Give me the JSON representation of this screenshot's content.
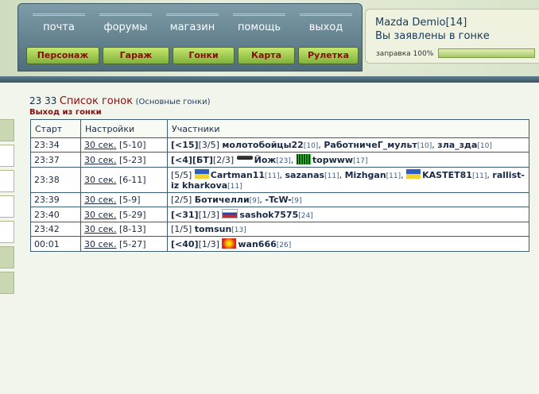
{
  "nav": {
    "links": [
      "почта",
      "форумы",
      "магазин",
      "помощь",
      "выход"
    ],
    "buttons": [
      "Персонаж",
      "Гараж",
      "Гонки",
      "Карта",
      "Рулетка"
    ]
  },
  "info": {
    "car": "Mazda Demio[14]",
    "status": "Вы заявлены в гонке",
    "fuel_label": "заправка 100%",
    "fuel_percent": 100
  },
  "page": {
    "time": "23 33",
    "title": "Список гонок",
    "subtitle": "(Основные гонки)",
    "exit_link": "Выход из гонки"
  },
  "table": {
    "headers": [
      "Старт",
      "Настройки",
      "Участники"
    ],
    "rows": [
      {
        "start": "23:34",
        "setting_link": "30 сек.",
        "setting_range": "[5-10]",
        "prefix": "[<15]",
        "count": "[3/5]",
        "participants": [
          {
            "name": "молотобойцы22",
            "level": "[10]"
          },
          {
            "name": "РаботничеГ_мульт",
            "level": "[10]"
          },
          {
            "name": "зла_зда",
            "level": "[10]"
          }
        ]
      },
      {
        "start": "23:37",
        "setting_link": "30 сек.",
        "setting_range": "[5-23]",
        "prefix": "[<4][БТ]",
        "count": "[2/3]",
        "participants": [
          {
            "name": "Йож",
            "level": "[23]",
            "icon": "knife"
          },
          {
            "name": "topwww",
            "level": "[17]",
            "icon": "matrix"
          }
        ]
      },
      {
        "start": "23:38",
        "setting_link": "30 сек.",
        "setting_range": "[6-11]",
        "prefix": "",
        "count": "[5/5]",
        "participants": [
          {
            "name": "Cartman11",
            "level": "[11]",
            "icon": "ua"
          },
          {
            "name": "sazanas",
            "level": "[11]"
          },
          {
            "name": "Mizhgan",
            "level": "[11]"
          },
          {
            "name": "KASTET81",
            "level": "[11]",
            "icon": "ua"
          },
          {
            "name": "rallist-iz kharkova",
            "level": "[11]"
          }
        ]
      },
      {
        "start": "23:39",
        "setting_link": "30 сек.",
        "setting_range": "[5-9]",
        "prefix": "",
        "count": "[2/5]",
        "participants": [
          {
            "name": "Ботичелли",
            "level": "[9]"
          },
          {
            "name": "-TcW-",
            "level": "[9]"
          }
        ]
      },
      {
        "start": "23:40",
        "setting_link": "30 сек.",
        "setting_range": "[5-29]",
        "prefix": "[<31]",
        "count": "[1/3]",
        "participants": [
          {
            "name": "sashok7575",
            "level": "[24]",
            "icon": "ru"
          }
        ]
      },
      {
        "start": "23:42",
        "setting_link": "30 сек.",
        "setting_range": "[8-13]",
        "prefix": "",
        "count": "[1/5]",
        "participants": [
          {
            "name": "tomsun",
            "level": "[13]"
          }
        ]
      },
      {
        "start": "00:01",
        "setting_link": "30 сек.",
        "setting_range": "[5-27]",
        "prefix": "[<40]",
        "count": "[1/3]",
        "participants": [
          {
            "name": "wan666",
            "level": "[26]",
            "icon": "flame"
          }
        ]
      }
    ]
  }
}
